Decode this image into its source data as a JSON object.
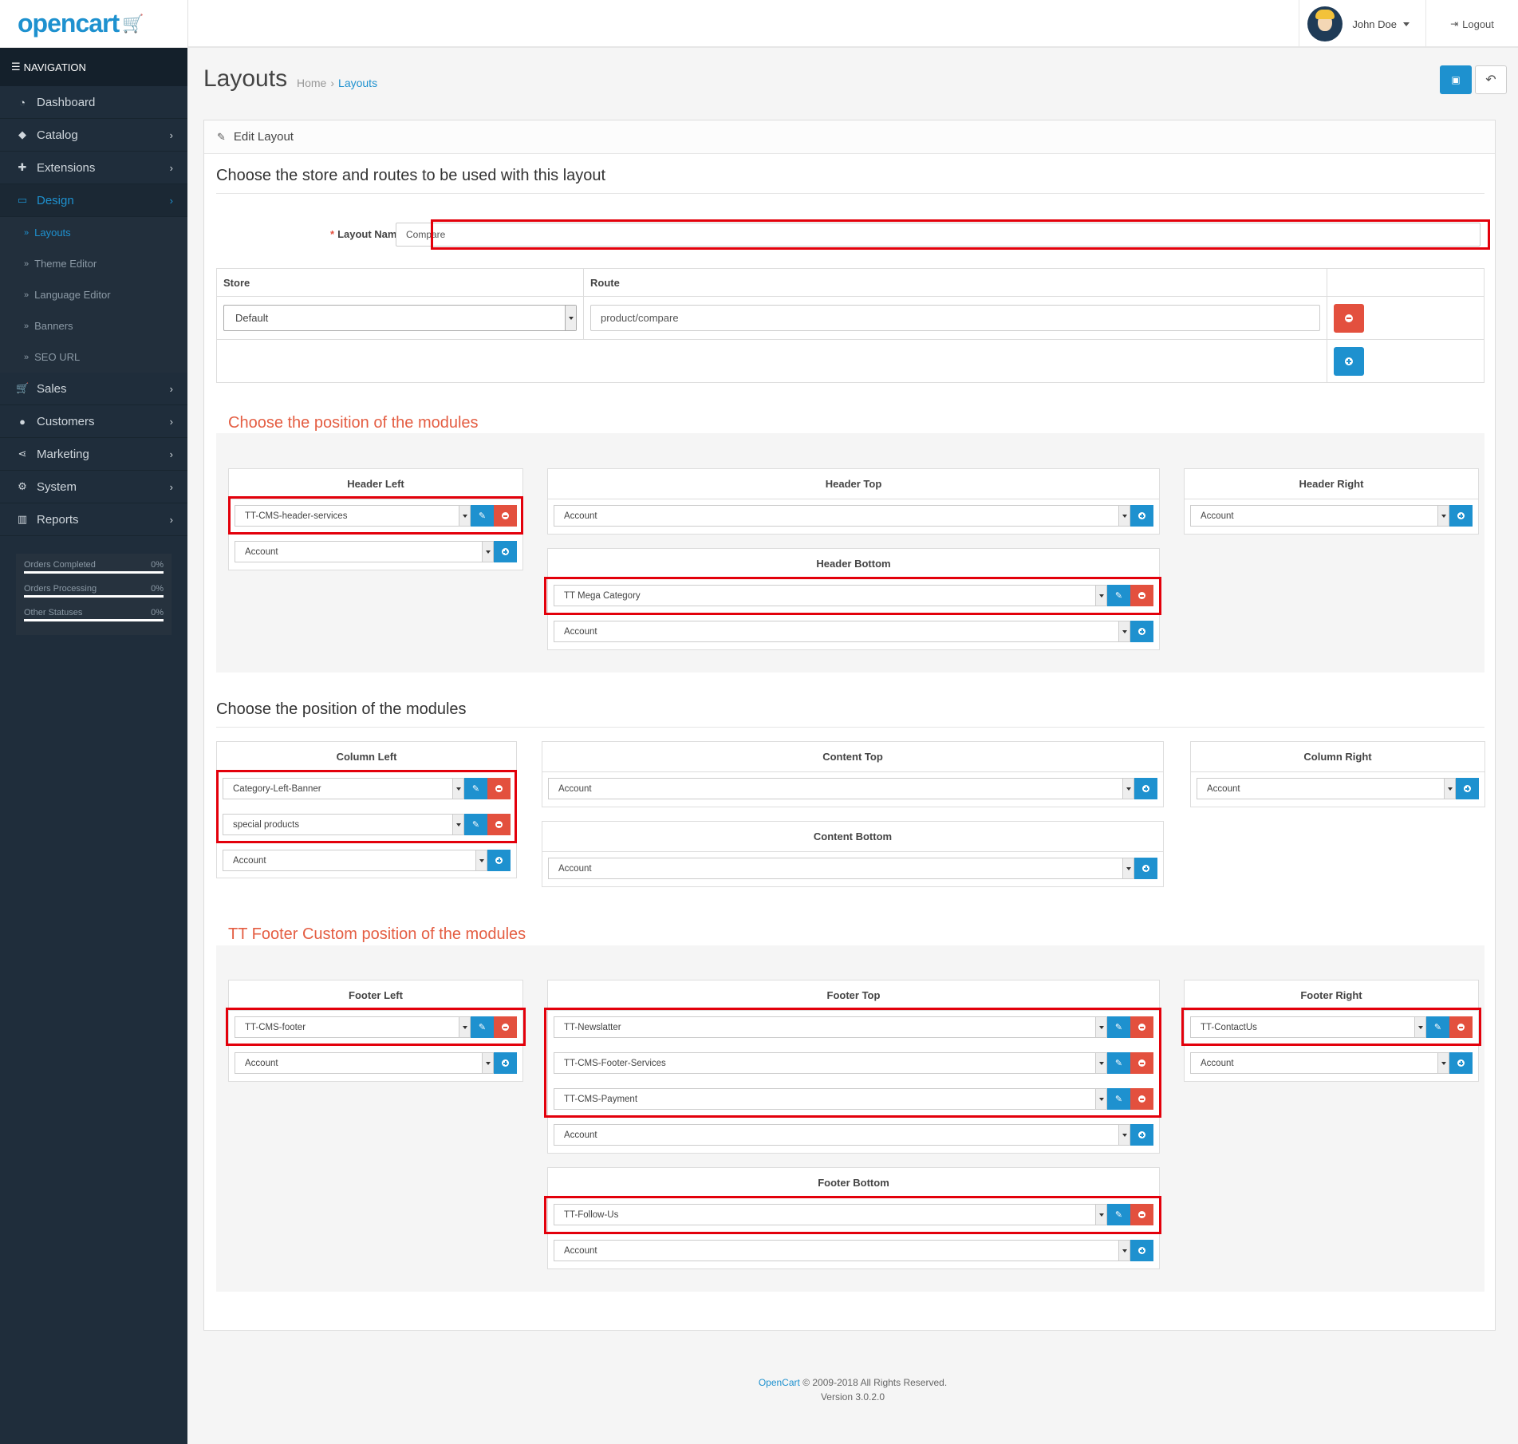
{
  "brand": {
    "logo": "opencart",
    "logo_icon": "cart-icon"
  },
  "topbar": {
    "user_name": "John Doe",
    "logout_label": "Logout"
  },
  "nav": {
    "heading": "NAVIGATION",
    "items": [
      {
        "label": "Dashboard",
        "icon": "dashboard-icon"
      },
      {
        "label": "Catalog",
        "icon": "tag-icon"
      },
      {
        "label": "Extensions",
        "icon": "puzzle-icon"
      },
      {
        "label": "Design",
        "icon": "monitor-icon"
      },
      {
        "label": "Sales",
        "icon": "cart-icon"
      },
      {
        "label": "Customers",
        "icon": "user-icon"
      },
      {
        "label": "Marketing",
        "icon": "share-icon"
      },
      {
        "label": "System",
        "icon": "gear-icon"
      },
      {
        "label": "Reports",
        "icon": "bar-chart-icon"
      }
    ],
    "design_sub": [
      "Layouts",
      "Theme Editor",
      "Language Editor",
      "Banners",
      "SEO URL"
    ]
  },
  "stats": [
    {
      "label": "Orders Completed",
      "value": "0%"
    },
    {
      "label": "Orders Processing",
      "value": "0%"
    },
    {
      "label": "Other Statuses",
      "value": "0%"
    }
  ],
  "page": {
    "title": "Layouts",
    "breadcrumb": [
      "Home",
      "Layouts"
    ]
  },
  "panel": {
    "heading": "Edit Layout",
    "legend_store": "Choose the store and routes to be used with this layout",
    "layout_name_label": "Layout Name",
    "layout_name_value": "Compare",
    "table": {
      "col_store": "Store",
      "col_route": "Route",
      "store_value": "Default",
      "route_value": "product/compare"
    },
    "legend_header_modules": "Choose the position of the modules",
    "legend_content_modules": "Choose the position of the modules",
    "legend_footer_modules": "TT Footer Custom position of the modules"
  },
  "positions": {
    "header_left": {
      "title": "Header Left",
      "modules": [
        "TT-CMS-header-services"
      ],
      "add": "Account"
    },
    "header_top": {
      "title": "Header Top",
      "modules": [],
      "add": "Account"
    },
    "header_right": {
      "title": "Header Right",
      "modules": [],
      "add": "Account"
    },
    "header_bottom": {
      "title": "Header Bottom",
      "modules": [
        "TT Mega Category"
      ],
      "add": "Account"
    },
    "column_left": {
      "title": "Column Left",
      "modules": [
        "Category-Left-Banner",
        "special products"
      ],
      "add": "Account"
    },
    "content_top": {
      "title": "Content Top",
      "modules": [],
      "add": "Account"
    },
    "column_right": {
      "title": "Column Right",
      "modules": [],
      "add": "Account"
    },
    "content_bottom": {
      "title": "Content Bottom",
      "modules": [],
      "add": "Account"
    },
    "footer_left": {
      "title": "Footer Left",
      "modules": [
        "TT-CMS-footer"
      ],
      "add": "Account"
    },
    "footer_top": {
      "title": "Footer Top",
      "modules": [
        "TT-Newslatter",
        "TT-CMS-Footer-Services",
        "TT-CMS-Payment"
      ],
      "add": "Account"
    },
    "footer_right": {
      "title": "Footer Right",
      "modules": [
        "TT-ContactUs"
      ],
      "add": "Account"
    },
    "footer_bottom": {
      "title": "Footer Bottom",
      "modules": [
        "TT-Follow-Us"
      ],
      "add": "Account"
    }
  },
  "footer": {
    "brand": "OpenCart",
    "copyright": "© 2009-2018 All Rights Reserved.",
    "version": "Version 3.0.2.0"
  },
  "colors": {
    "accent": "#1e91cf",
    "danger": "#e3503e",
    "sidebar": "#1f2d3b",
    "highlight_box": "#e3000b"
  }
}
